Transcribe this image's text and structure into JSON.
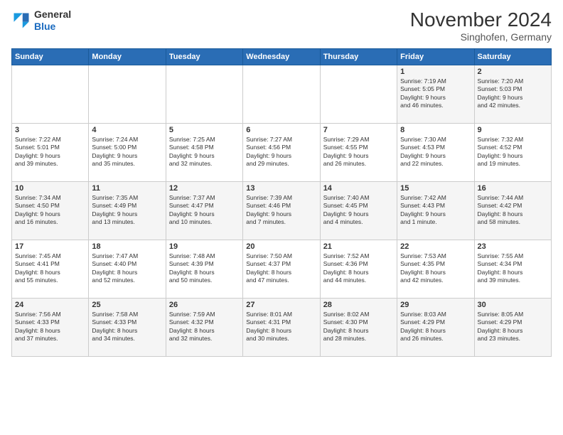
{
  "header": {
    "logo_general": "General",
    "logo_blue": "Blue",
    "month_title": "November 2024",
    "subtitle": "Singhofen, Germany"
  },
  "weekdays": [
    "Sunday",
    "Monday",
    "Tuesday",
    "Wednesday",
    "Thursday",
    "Friday",
    "Saturday"
  ],
  "weeks": [
    [
      {
        "day": "",
        "info": ""
      },
      {
        "day": "",
        "info": ""
      },
      {
        "day": "",
        "info": ""
      },
      {
        "day": "",
        "info": ""
      },
      {
        "day": "",
        "info": ""
      },
      {
        "day": "1",
        "info": "Sunrise: 7:19 AM\nSunset: 5:05 PM\nDaylight: 9 hours\nand 46 minutes."
      },
      {
        "day": "2",
        "info": "Sunrise: 7:20 AM\nSunset: 5:03 PM\nDaylight: 9 hours\nand 42 minutes."
      }
    ],
    [
      {
        "day": "3",
        "info": "Sunrise: 7:22 AM\nSunset: 5:01 PM\nDaylight: 9 hours\nand 39 minutes."
      },
      {
        "day": "4",
        "info": "Sunrise: 7:24 AM\nSunset: 5:00 PM\nDaylight: 9 hours\nand 35 minutes."
      },
      {
        "day": "5",
        "info": "Sunrise: 7:25 AM\nSunset: 4:58 PM\nDaylight: 9 hours\nand 32 minutes."
      },
      {
        "day": "6",
        "info": "Sunrise: 7:27 AM\nSunset: 4:56 PM\nDaylight: 9 hours\nand 29 minutes."
      },
      {
        "day": "7",
        "info": "Sunrise: 7:29 AM\nSunset: 4:55 PM\nDaylight: 9 hours\nand 26 minutes."
      },
      {
        "day": "8",
        "info": "Sunrise: 7:30 AM\nSunset: 4:53 PM\nDaylight: 9 hours\nand 22 minutes."
      },
      {
        "day": "9",
        "info": "Sunrise: 7:32 AM\nSunset: 4:52 PM\nDaylight: 9 hours\nand 19 minutes."
      }
    ],
    [
      {
        "day": "10",
        "info": "Sunrise: 7:34 AM\nSunset: 4:50 PM\nDaylight: 9 hours\nand 16 minutes."
      },
      {
        "day": "11",
        "info": "Sunrise: 7:35 AM\nSunset: 4:49 PM\nDaylight: 9 hours\nand 13 minutes."
      },
      {
        "day": "12",
        "info": "Sunrise: 7:37 AM\nSunset: 4:47 PM\nDaylight: 9 hours\nand 10 minutes."
      },
      {
        "day": "13",
        "info": "Sunrise: 7:39 AM\nSunset: 4:46 PM\nDaylight: 9 hours\nand 7 minutes."
      },
      {
        "day": "14",
        "info": "Sunrise: 7:40 AM\nSunset: 4:45 PM\nDaylight: 9 hours\nand 4 minutes."
      },
      {
        "day": "15",
        "info": "Sunrise: 7:42 AM\nSunset: 4:43 PM\nDaylight: 9 hours\nand 1 minute."
      },
      {
        "day": "16",
        "info": "Sunrise: 7:44 AM\nSunset: 4:42 PM\nDaylight: 8 hours\nand 58 minutes."
      }
    ],
    [
      {
        "day": "17",
        "info": "Sunrise: 7:45 AM\nSunset: 4:41 PM\nDaylight: 8 hours\nand 55 minutes."
      },
      {
        "day": "18",
        "info": "Sunrise: 7:47 AM\nSunset: 4:40 PM\nDaylight: 8 hours\nand 52 minutes."
      },
      {
        "day": "19",
        "info": "Sunrise: 7:48 AM\nSunset: 4:39 PM\nDaylight: 8 hours\nand 50 minutes."
      },
      {
        "day": "20",
        "info": "Sunrise: 7:50 AM\nSunset: 4:37 PM\nDaylight: 8 hours\nand 47 minutes."
      },
      {
        "day": "21",
        "info": "Sunrise: 7:52 AM\nSunset: 4:36 PM\nDaylight: 8 hours\nand 44 minutes."
      },
      {
        "day": "22",
        "info": "Sunrise: 7:53 AM\nSunset: 4:35 PM\nDaylight: 8 hours\nand 42 minutes."
      },
      {
        "day": "23",
        "info": "Sunrise: 7:55 AM\nSunset: 4:34 PM\nDaylight: 8 hours\nand 39 minutes."
      }
    ],
    [
      {
        "day": "24",
        "info": "Sunrise: 7:56 AM\nSunset: 4:33 PM\nDaylight: 8 hours\nand 37 minutes."
      },
      {
        "day": "25",
        "info": "Sunrise: 7:58 AM\nSunset: 4:33 PM\nDaylight: 8 hours\nand 34 minutes."
      },
      {
        "day": "26",
        "info": "Sunrise: 7:59 AM\nSunset: 4:32 PM\nDaylight: 8 hours\nand 32 minutes."
      },
      {
        "day": "27",
        "info": "Sunrise: 8:01 AM\nSunset: 4:31 PM\nDaylight: 8 hours\nand 30 minutes."
      },
      {
        "day": "28",
        "info": "Sunrise: 8:02 AM\nSunset: 4:30 PM\nDaylight: 8 hours\nand 28 minutes."
      },
      {
        "day": "29",
        "info": "Sunrise: 8:03 AM\nSunset: 4:29 PM\nDaylight: 8 hours\nand 26 minutes."
      },
      {
        "day": "30",
        "info": "Sunrise: 8:05 AM\nSunset: 4:29 PM\nDaylight: 8 hours\nand 23 minutes."
      }
    ]
  ]
}
